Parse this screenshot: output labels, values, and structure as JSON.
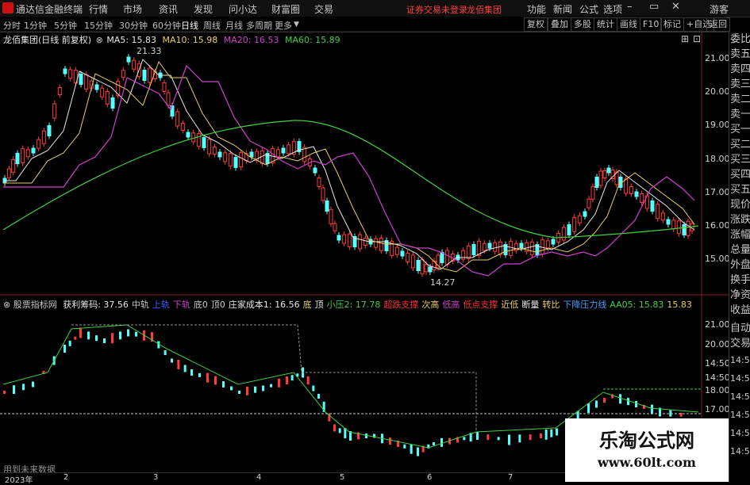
{
  "app": {
    "title": "通达信金融终端"
  },
  "menu": {
    "items": [
      "行情",
      "市场",
      "资讯",
      "发现",
      "问小达",
      "财富圈",
      "交易"
    ],
    "notice": "证券交易未登录",
    "stock_name": "龙佰集团",
    "right_items": [
      "功能",
      "新闻",
      "公式",
      "选项"
    ],
    "guest": "游客"
  },
  "periods": [
    "分时",
    "1分钟",
    "5分钟",
    "15分钟",
    "30分钟",
    "60分钟",
    "日线",
    "周线",
    "月线",
    "多周期",
    "更多"
  ],
  "active_period": "日线",
  "toolbar_right": [
    "复权",
    "叠加",
    "多股",
    "统计",
    "画线",
    "F10",
    "标记",
    "+自选",
    "返回"
  ],
  "main_chart": {
    "title": "龙佰集团(日线 前复权)",
    "ma": [
      {
        "label": "MA5: 15.83",
        "color": "#e8e8e8"
      },
      {
        "label": "MA10: 15.98",
        "color": "#e8d060"
      },
      {
        "label": "MA20: 16.53",
        "color": "#d040d0"
      },
      {
        "label": "MA60: 15.89",
        "color": "#40d040"
      }
    ],
    "price_axis": [
      "21.00",
      "20.00",
      "19.00",
      "18.00",
      "17.00",
      "16.00",
      "15.00"
    ],
    "high_label": "21.33",
    "low_label": "14.27"
  },
  "indicator": {
    "name": "股票指标网",
    "items": [
      {
        "text": "获利筹码: 37.56",
        "color": "#e8e8e8"
      },
      {
        "text": "中轨",
        "color": "#c8c8c8"
      },
      {
        "text": "上轨",
        "color": "#4060ff"
      },
      {
        "text": "下轨",
        "color": "#d040d0"
      },
      {
        "text": "底0",
        "color": "#c8c8c8"
      },
      {
        "text": "顶0",
        "color": "#c8c8c8"
      },
      {
        "text": "庄家成本1: 16.56",
        "color": "#e8e8e8"
      },
      {
        "text": "底",
        "color": "#e8d060"
      },
      {
        "text": "顶",
        "color": "#e8e8e8"
      },
      {
        "text": "小压2: 17.78",
        "color": "#40d040"
      },
      {
        "text": "超跌支撑",
        "color": "#ff3030"
      },
      {
        "text": "次高",
        "color": "#e8d060"
      },
      {
        "text": "低高",
        "color": "#d040d0"
      },
      {
        "text": "低点支撑",
        "color": "#ff3030"
      },
      {
        "text": "近低",
        "color": "#e8d060"
      },
      {
        "text": "断量",
        "color": "#e8e8e8"
      },
      {
        "text": "转比",
        "color": "#e8d060"
      },
      {
        "text": "下降压力线",
        "color": "#40a0ff"
      },
      {
        "text": "AA05: 15.83",
        "color": "#40d040"
      },
      {
        "text": "15.83",
        "color": "#e8d060"
      }
    ],
    "axis": [
      "21.00",
      "20.00",
      "14:50",
      "14:50",
      "14:50",
      "18.00",
      "14:50",
      "17.00",
      "14:50"
    ],
    "footer_note": "用到未来数据"
  },
  "xaxis": {
    "labels": [
      "2023年",
      "2",
      "3",
      "4",
      "5",
      "6",
      "7"
    ]
  },
  "right_panel": [
    "委比",
    "卖五",
    "卖四",
    "卖三",
    "卖二",
    "卖一",
    "买一",
    "买二",
    "买三",
    "买四",
    "买五",
    "现价",
    "涨跌",
    "涨幅",
    "总量",
    "外盘",
    "换手",
    "净资",
    "收益",
    "自动",
    "交易",
    "14:50",
    "14:50",
    "14:50",
    "14:50",
    "14:50",
    "14:50"
  ],
  "watermark": {
    "title": "乐淘公式网",
    "url": "www.60lt.com"
  }
}
